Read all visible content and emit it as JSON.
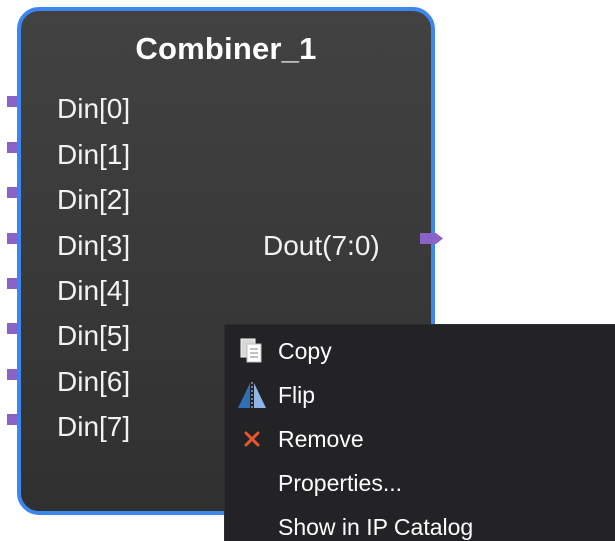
{
  "block": {
    "title": "Combiner_1",
    "inputs": [
      "Din[0]",
      "Din[1]",
      "Din[2]",
      "Din[3]",
      "Din[4]",
      "Din[5]",
      "Din[6]",
      "Din[7]"
    ],
    "output": "Dout(7:0)"
  },
  "context_menu": {
    "items": [
      {
        "label": "Copy",
        "icon": "copy-icon"
      },
      {
        "label": "Flip",
        "icon": "flip-icon"
      },
      {
        "label": "Remove",
        "icon": "remove-icon"
      },
      {
        "label": "Properties...",
        "icon": ""
      },
      {
        "label": "Show in IP Catalog",
        "icon": ""
      }
    ]
  },
  "colors": {
    "block_border": "#3d86f0",
    "block_fill": "#3a3a3a",
    "pin": "#8a63c8",
    "menu_bg": "#232326",
    "remove_icon": "#e9552f"
  }
}
